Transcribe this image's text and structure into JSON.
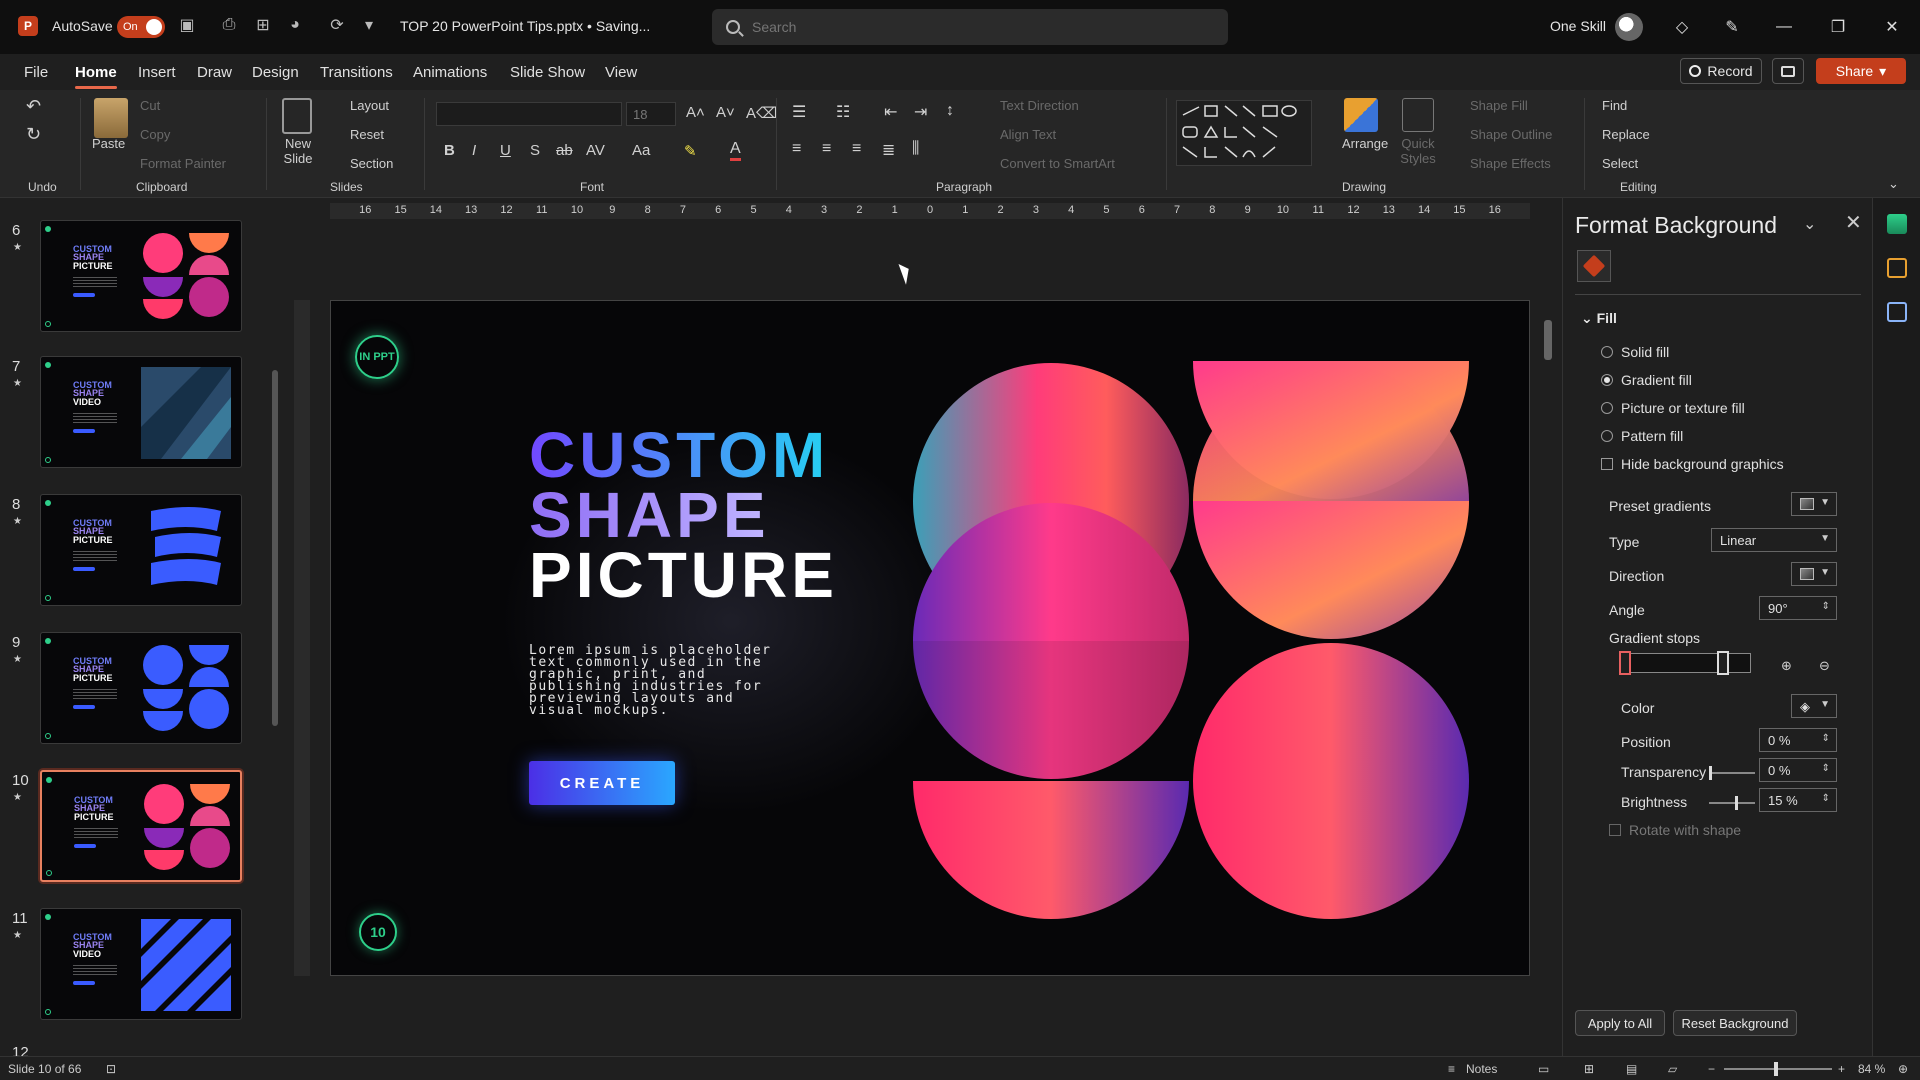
{
  "titlebar": {
    "autosave_label": "AutoSave",
    "autosave_state": "On",
    "doc_title": "TOP 20 PowerPoint Tips.pptx • Saving...",
    "search_placeholder": "Search",
    "user_name": "One Skill"
  },
  "menu": {
    "tabs": [
      "File",
      "Home",
      "Insert",
      "Draw",
      "Design",
      "Transitions",
      "Animations",
      "Slide Show",
      "View"
    ],
    "active": "Home",
    "record_label": "Record",
    "share_label": "Share"
  },
  "ribbon": {
    "undo_group": "Undo",
    "clipboard": {
      "label": "Clipboard",
      "paste": "Paste",
      "cut": "Cut",
      "copy": "Copy",
      "format_painter": "Format Painter"
    },
    "slides": {
      "label": "Slides",
      "new_slide": "New Slide",
      "layout": "Layout",
      "reset": "Reset",
      "section": "Section"
    },
    "font": {
      "label": "Font",
      "size": "18"
    },
    "paragraph": {
      "label": "Paragraph",
      "text_direction": "Text Direction",
      "align_text": "Align Text",
      "convert": "Convert to SmartArt"
    },
    "drawing": {
      "label": "Drawing",
      "arrange": "Arrange",
      "quick_styles": "Quick Styles",
      "shape_fill": "Shape Fill",
      "shape_outline": "Shape Outline",
      "shape_effects": "Shape Effects"
    },
    "editing": {
      "label": "Editing",
      "find": "Find",
      "replace": "Replace",
      "select": "Select"
    }
  },
  "thumbnails": [
    {
      "num": "6",
      "l1": "CUSTOM",
      "l2": "SHAPE",
      "l3": "PICTURE",
      "art": "photo"
    },
    {
      "num": "7",
      "l1": "CUSTOM",
      "l2": "SHAPE",
      "l3": "VIDEO",
      "art": "video"
    },
    {
      "num": "8",
      "l1": "CUSTOM",
      "l2": "SHAPE",
      "l3": "PICTURE",
      "art": "waves"
    },
    {
      "num": "9",
      "l1": "CUSTOM",
      "l2": "SHAPE",
      "l3": "PICTURE",
      "art": "blue"
    },
    {
      "num": "10",
      "l1": "CUSTOM",
      "l2": "SHAPE",
      "l3": "PICTURE",
      "art": "photo",
      "active": true
    },
    {
      "num": "11",
      "l1": "CUSTOM",
      "l2": "SHAPE",
      "l3": "VIDEO",
      "art": "stripes"
    }
  ],
  "next_thumb_num": "12",
  "ruler_ticks": [
    "16",
    "15",
    "14",
    "13",
    "12",
    "11",
    "10",
    "9",
    "8",
    "7",
    "6",
    "5",
    "4",
    "3",
    "2",
    "1",
    "0",
    "1",
    "2",
    "3",
    "4",
    "5",
    "6",
    "7",
    "8",
    "9",
    "10",
    "11",
    "12",
    "13",
    "14",
    "15",
    "16"
  ],
  "slide": {
    "logo_text": "IN PPT",
    "title_line1": "CUSTOM",
    "title_line2": "SHAPE",
    "title_line3": "PICTURE",
    "body": "Lorem ipsum is placeholder text commonly used in the graphic, print, and publishing industries for previewing layouts and visual mockups.",
    "button": "CREATE",
    "page_number": "10"
  },
  "format_pane": {
    "title": "Format Background",
    "fill_header": "Fill",
    "options": [
      {
        "label": "Solid fill",
        "selected": false
      },
      {
        "label": "Gradient fill",
        "selected": true
      },
      {
        "label": "Picture or texture fill",
        "selected": false
      },
      {
        "label": "Pattern fill",
        "selected": false
      }
    ],
    "hide_bg_label": "Hide background graphics",
    "preset_label": "Preset gradients",
    "type_label": "Type",
    "type_value": "Linear",
    "direction_label": "Direction",
    "angle_label": "Angle",
    "angle_value": "90°",
    "stops_label": "Gradient stops",
    "color_label": "Color",
    "position_label": "Position",
    "position_value": "0 %",
    "transparency_label": "Transparency",
    "transparency_value": "0 %",
    "brightness_label": "Brightness",
    "brightness_value": "15 %",
    "rotate_label": "Rotate with shape",
    "apply_all": "Apply to All",
    "reset_bg": "Reset Background"
  },
  "status": {
    "slide_info": "Slide 10 of 66",
    "notes": "Notes",
    "zoom": "84 %"
  },
  "colors": {
    "accent": "#c43e1c",
    "active_tab": "#e8684a",
    "green": "#2ecf8a"
  }
}
